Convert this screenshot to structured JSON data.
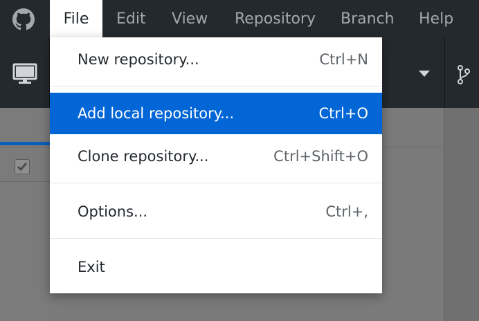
{
  "menubar": {
    "logo_icon": "github-octocat-icon",
    "items": [
      {
        "label": "File",
        "active": true
      },
      {
        "label": "Edit"
      },
      {
        "label": "View"
      },
      {
        "label": "Repository"
      },
      {
        "label": "Branch"
      },
      {
        "label": "Help"
      }
    ]
  },
  "file_menu": {
    "items": [
      {
        "label": "New repository...",
        "shortcut": "Ctrl+N"
      },
      {
        "label": "Add local repository...",
        "shortcut": "Ctrl+O",
        "highlighted": true
      },
      {
        "label": "Clone repository...",
        "shortcut": "Ctrl+Shift+O"
      },
      {
        "label": "Options...",
        "shortcut": "Ctrl+,"
      },
      {
        "label": "Exit",
        "shortcut": ""
      }
    ]
  },
  "colors": {
    "menubar_bg": "#24292e",
    "highlight": "#0366d6",
    "menu_text_inactive": "#a3a8ad"
  }
}
